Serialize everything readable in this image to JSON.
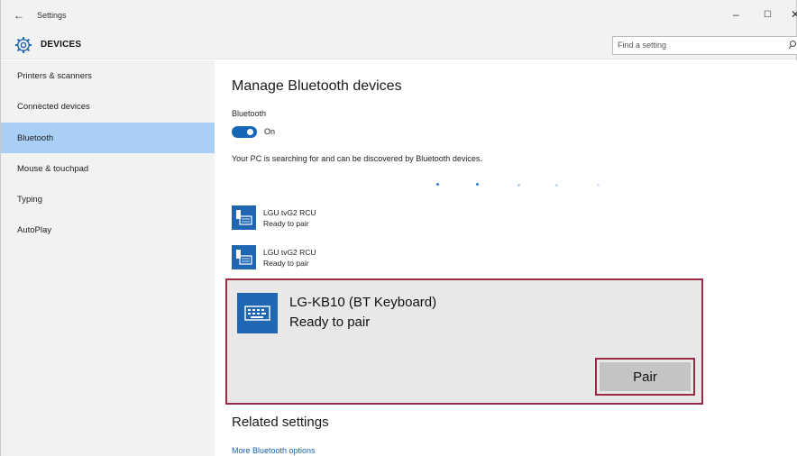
{
  "window": {
    "title": "Settings",
    "back_glyph": "←",
    "minimize_glyph": "–",
    "maximize_glyph": "☐",
    "close_glyph": "✕"
  },
  "header": {
    "icon": "gear-icon",
    "heading": "DEVICES",
    "search_placeholder": "Find a setting",
    "search_icon": "search-icon"
  },
  "sidebar": {
    "items": [
      {
        "label": "Printers & scanners",
        "active": false
      },
      {
        "label": "Connected devices",
        "active": false
      },
      {
        "label": "Bluetooth",
        "active": true
      },
      {
        "label": "Mouse & touchpad",
        "active": false
      },
      {
        "label": "Typing",
        "active": false
      },
      {
        "label": "AutoPlay",
        "active": false
      }
    ]
  },
  "main": {
    "title": "Manage Bluetooth devices",
    "bluetooth_label": "Bluetooth",
    "toggle_state": "On",
    "description": "Your PC is searching for and can be discovered by Bluetooth devices.",
    "devices": [
      {
        "name": "LGU tvG2 RCU",
        "status": "Ready to pair",
        "icon": "remote-control-icon"
      },
      {
        "name": "LGU tvG2 RCU",
        "status": "Ready to pair",
        "icon": "remote-control-icon"
      }
    ],
    "selected_device": {
      "name": "LG-KB10 (BT Keyboard)",
      "status": "Ready to pair",
      "icon": "keyboard-icon",
      "pair_label": "Pair"
    },
    "related_heading": "Related settings",
    "more_link": "More Bluetooth options"
  },
  "colors": {
    "accent": "#1666b8",
    "sidebar_bg": "#f2f2f2",
    "active_item": "#a9cff5",
    "highlight_border": "#9c2a47",
    "link": "#1a62b8"
  }
}
